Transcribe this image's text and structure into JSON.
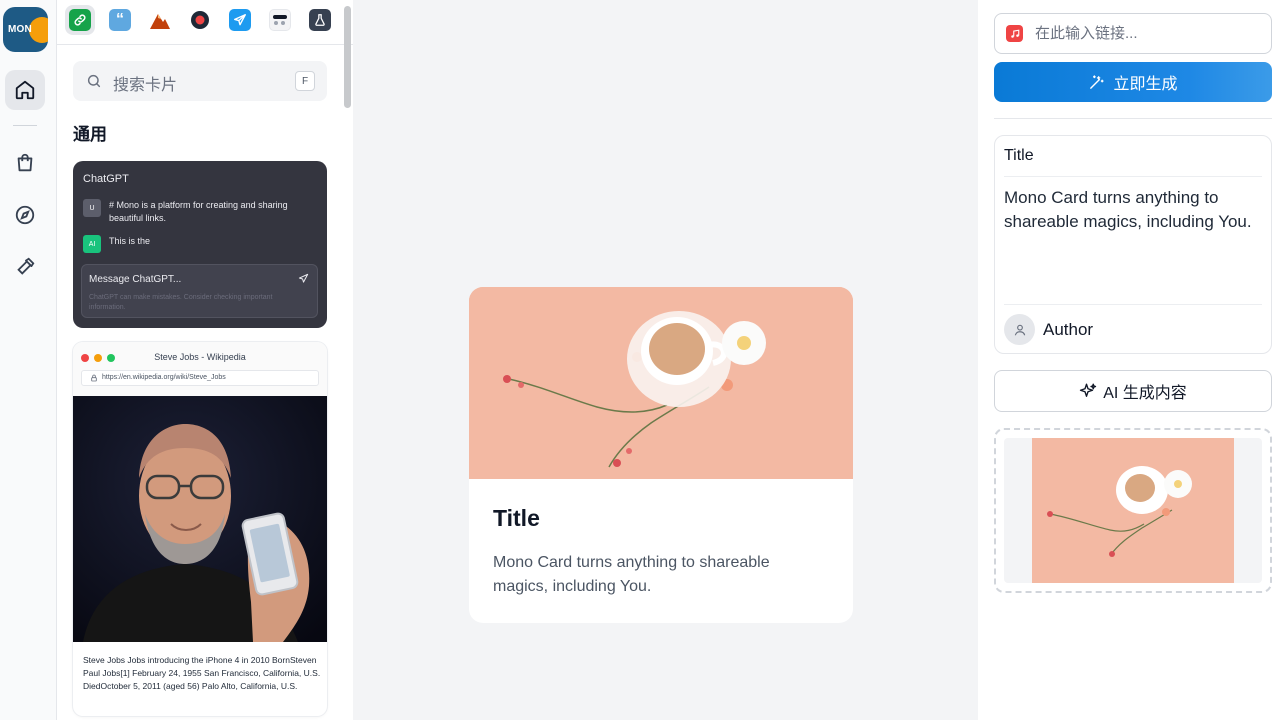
{
  "brand": {
    "logo_text": "MON"
  },
  "colors": {
    "accent": "#1e88e5",
    "peach": "#f3b9a3",
    "gpt_green": "#19c37d"
  },
  "rail": {
    "items": [
      "home-icon",
      "shopping-bag-icon",
      "compass-icon",
      "hammer-icon"
    ]
  },
  "app_tabs": [
    "link-icon",
    "quote-icon",
    "mountain-icon",
    "record-icon",
    "telegram-icon",
    "toggle-icon",
    "flask-icon"
  ],
  "search": {
    "placeholder": "搜索卡片",
    "shortcut": "F"
  },
  "section": {
    "title": "通用"
  },
  "gpt_card": {
    "header": "ChatGPT",
    "user_avatar": "U",
    "user_msg": "# Mono is a platform for creating and sharing beautiful links.",
    "ai_avatar": "AI",
    "ai_msg": "This is the",
    "composer_placeholder": "Message ChatGPT...",
    "disclaimer": "ChatGPT can make mistakes. Consider checking important information."
  },
  "wiki_card": {
    "title": "Steve Jobs - Wikipedia",
    "url": "https://en.wikipedia.org/wiki/Steve_Jobs",
    "caption": "Steve Jobs Jobs introducing the iPhone 4 in 2010 BornSteven Paul Jobs[1] February 24, 1955 San Francisco, California, U.S. DiedOctober 5, 2011 (aged 56) Palo Alto, California, U.S."
  },
  "preview": {
    "title": "Title",
    "description": "Mono Card turns anything to shareable magics, including You."
  },
  "editor": {
    "link_placeholder": "在此输入链接...",
    "generate_label": "立即生成",
    "title_value": "Title",
    "desc_value": "Mono Card turns anything to shareable magics, including You.",
    "author_value": "Author",
    "ai_label": "AI 生成内容"
  }
}
